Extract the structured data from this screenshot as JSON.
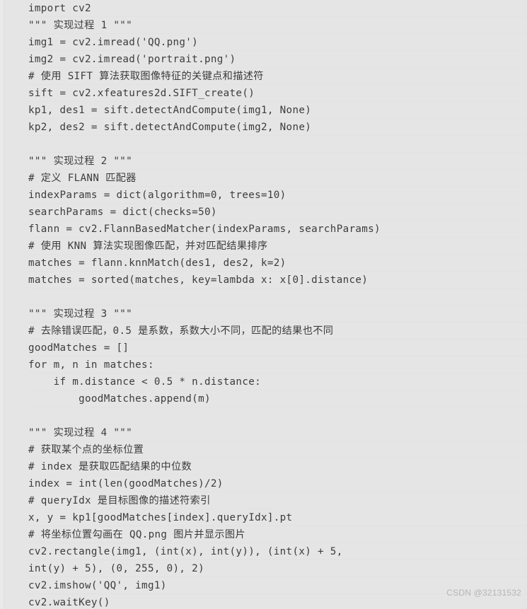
{
  "code_block": {
    "language": "python",
    "background_color": "#e5e5e5",
    "text_color": "#3c3c3c",
    "line_separator_color": "#e2e2e2",
    "lines": [
      "import cv2",
      "\"\"\" 实现过程 1 \"\"\"",
      "img1 = cv2.imread('QQ.png')",
      "img2 = cv2.imread('portrait.png')",
      "# 使用 SIFT 算法获取图像特征的关键点和描述符",
      "sift = cv2.xfeatures2d.SIFT_create()",
      "kp1, des1 = sift.detectAndCompute(img1, None)",
      "kp2, des2 = sift.detectAndCompute(img2, None)",
      "",
      "\"\"\" 实现过程 2 \"\"\"",
      "# 定义 FLANN 匹配器",
      "indexParams = dict(algorithm=0, trees=10)",
      "searchParams = dict(checks=50)",
      "flann = cv2.FlannBasedMatcher(indexParams, searchParams)",
      "# 使用 KNN 算法实现图像匹配，并对匹配结果排序",
      "matches = flann.knnMatch(des1, des2, k=2)",
      "matches = sorted(matches, key=lambda x: x[0].distance)",
      "",
      "\"\"\" 实现过程 3 \"\"\"",
      "# 去除错误匹配，0.5 是系数，系数大小不同，匹配的结果也不同",
      "goodMatches = []",
      "for m, n in matches:",
      "    if m.distance < 0.5 * n.distance:",
      "        goodMatches.append(m)",
      "",
      "\"\"\" 实现过程 4 \"\"\"",
      "# 获取某个点的坐标位置",
      "# index 是获取匹配结果的中位数",
      "index = int(len(goodMatches)/2)",
      "# queryIdx 是目标图像的描述符索引",
      "x, y = kp1[goodMatches[index].queryIdx].pt",
      "# 将坐标位置勾画在 QQ.png 图片并显示图片",
      "cv2.rectangle(img1, (int(x), int(y)), (int(x) + 5,",
      "int(y) + 5), (0, 255, 0), 2)",
      "cv2.imshow('QQ', img1)",
      "cv2.waitKey()"
    ]
  },
  "watermark": {
    "text": "CSDN @32131532",
    "color": "#b6b6b6"
  }
}
